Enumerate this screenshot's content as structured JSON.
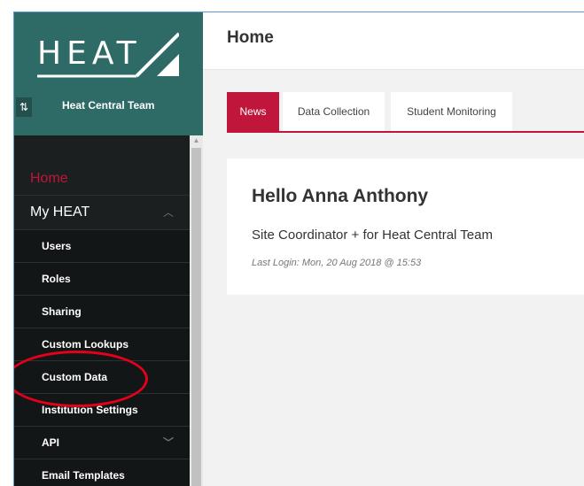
{
  "brand": {
    "logo_text": "HEAT",
    "team_name": "Heat Central Team",
    "switch_icon": "swap-vertical-icon"
  },
  "nav": {
    "home": "Home",
    "my_heat": "My HEAT",
    "my_heat_chevron": "chevron-up-icon",
    "items": [
      {
        "label": "Users"
      },
      {
        "label": "Roles"
      },
      {
        "label": "Sharing"
      },
      {
        "label": "Custom Lookups"
      },
      {
        "label": "Custom Data"
      },
      {
        "label": "Institution Settings"
      },
      {
        "label": "API",
        "chevron": "chevron-down-icon"
      },
      {
        "label": "Email Templates"
      }
    ]
  },
  "header": {
    "title": "Home"
  },
  "tabs": [
    {
      "label": "News",
      "active": true
    },
    {
      "label": "Data Collection",
      "active": false
    },
    {
      "label": "Student Monitoring",
      "active": false
    }
  ],
  "card": {
    "greeting": "Hello Anna Anthony",
    "role": "Site Coordinator + for Heat Central Team",
    "last_login": "Last Login: Mon, 20 Aug 2018 @ 15:53"
  },
  "colors": {
    "accent": "#c1163c",
    "sidebar_brand": "#2f6b66",
    "sidebar_bg": "#1b1f1f",
    "annotation": "#e3001b"
  }
}
